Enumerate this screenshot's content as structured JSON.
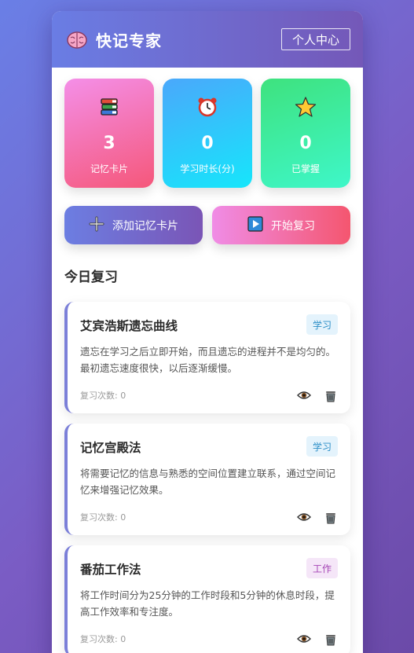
{
  "header": {
    "title": "快记专家",
    "profile_label": "个人中心",
    "logo_icon": "brain-icon"
  },
  "stats": [
    {
      "value": "3",
      "label": "记忆卡片",
      "icon": "books-icon"
    },
    {
      "value": "0",
      "label": "学习时长(分)",
      "icon": "alarm-clock-icon"
    },
    {
      "value": "0",
      "label": "已掌握",
      "icon": "star-icon"
    }
  ],
  "actions": {
    "add_label": "添加记忆卡片",
    "review_label": "开始复习"
  },
  "section_title": "今日复习",
  "cards": [
    {
      "title": "艾宾浩斯遗忘曲线",
      "tag": "学习",
      "desc": "遗忘在学习之后立即开始，而且遗忘的进程并不是均匀的。最初遗忘速度很快，以后逐渐缓慢。",
      "review_count": "复习次数: 0"
    },
    {
      "title": "记忆宫殿法",
      "tag": "学习",
      "desc": "将需要记忆的信息与熟悉的空间位置建立联系，通过空间记忆来增强记忆效果。",
      "review_count": "复习次数: 0"
    },
    {
      "title": "番茄工作法",
      "tag": "工作",
      "desc": "将工作时间分为25分钟的工作时段和5分钟的休息时段，提高工作效率和专注度。",
      "review_count": "复习次数: 0"
    }
  ],
  "colors": {
    "accent": "#7458b8",
    "card_border": "#7b7fd8"
  }
}
